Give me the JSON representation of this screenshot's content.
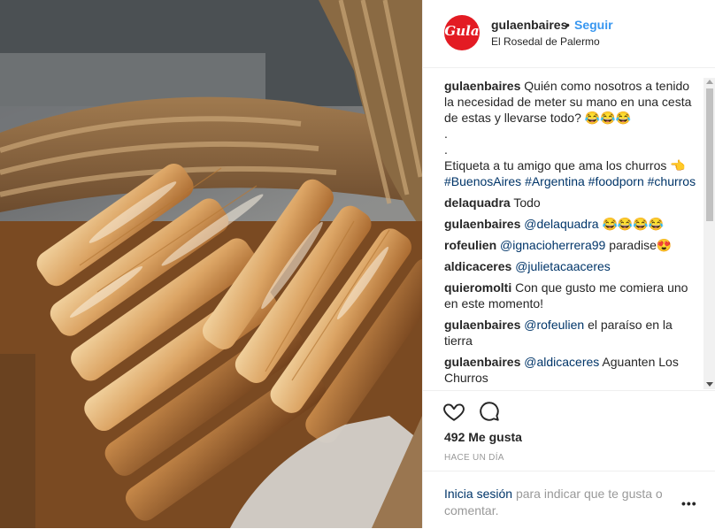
{
  "post": {
    "image_alt": "churros",
    "header": {
      "avatar_text": "Gula",
      "username": "gulaenbaires",
      "separator": "•",
      "follow_label": "Seguir",
      "location": "El Rosedal de Palermo"
    },
    "caption": {
      "username": "gulaenbaires",
      "text": "Quién como nosotros a tenido la necesidad de meter su mano en una cesta de estas y llevarse todo? 😂😂😂",
      "dot1": ".",
      "dot2": ".",
      "line2": "Etiqueta a tu amigo que ama los churros 👈",
      "hashtags": [
        "#BuenosAires",
        "#Argentina",
        "#foodporn",
        "#churros"
      ]
    },
    "comments": [
      {
        "user": "delaquadra",
        "mention": "",
        "text": "Todo"
      },
      {
        "user": "gulaenbaires",
        "mention": "@delaquadra",
        "text": "😂😂😂😂"
      },
      {
        "user": "rofeulien",
        "mention": "@ignacioherrera99",
        "text": "paradise😍"
      },
      {
        "user": "aldicaceres",
        "mention": "@julietacaaceres",
        "text": ""
      },
      {
        "user": "quieromolti",
        "mention": "",
        "text": "Con que gusto me comiera uno en este momento!"
      },
      {
        "user": "gulaenbaires",
        "mention": "@rofeulien",
        "text": "el paraíso en la tierra"
      },
      {
        "user": "gulaenbaires",
        "mention": "@aldicaceres",
        "text": "Aguanten Los Churros"
      }
    ],
    "likes": "492 Me gusta",
    "time": "HACE UN DÍA",
    "footer": {
      "login_link": "Inicia sesión",
      "login_text": "para indicar que te gusta o comentar.",
      "more": "•••"
    },
    "icons": {
      "like": "heart-icon",
      "comment": "comment-icon",
      "more": "more-options-icon"
    },
    "colors": {
      "accent": "#3897f0",
      "link": "#003569",
      "brand": "#e31b23"
    }
  }
}
